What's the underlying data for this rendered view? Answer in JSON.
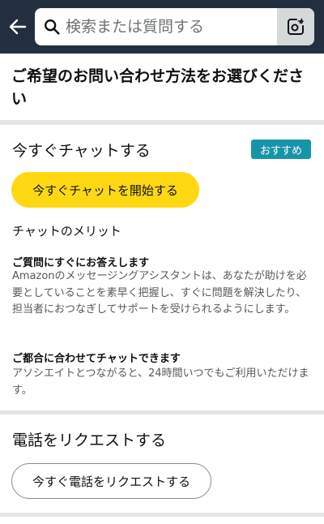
{
  "search": {
    "placeholder": "検索または質問する"
  },
  "icons": {
    "back": "back-arrow-icon",
    "search": "search-icon",
    "lens": "camera-lens-icon"
  },
  "page_heading": "ご希望のお問い合わせ方法をお選びください",
  "chat_section": {
    "title": "今すぐチャットする",
    "badge": "おすすめ",
    "button": "今すぐチャットを開始する",
    "merits_heading": "チャットのメリット",
    "merits": [
      {
        "title": "ご質問にすぐにお答えします",
        "body": "Amazonのメッセージングアシスタントは、あなたが助けを必要としていることを素早く把握し、すぐに問題を解決したり、担当者におつなぎしてサポートを受けられるようにします。"
      },
      {
        "title": "ご都合に合わせてチャットできます",
        "body": "アソシエイトとつながると、24時間いつでもご利用いただけます。"
      }
    ]
  },
  "call_section": {
    "title": "電話をリクエストする",
    "button": "今すぐ電話をリクエストする"
  },
  "colors": {
    "header_bg": "#232f3e",
    "primary_button": "#ffd814",
    "badge_bg": "#1795a8",
    "divider": "#e3e6e6"
  }
}
